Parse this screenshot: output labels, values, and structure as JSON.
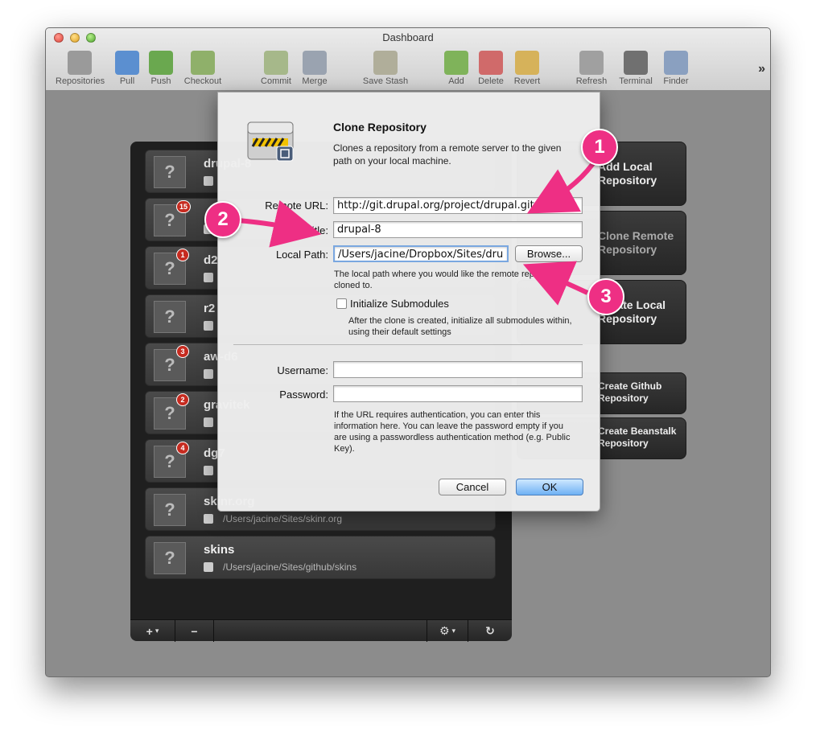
{
  "window": {
    "title": "Dashboard"
  },
  "toolbar": {
    "items": [
      {
        "label": "Repositories",
        "icon": "repositories-icon",
        "color": "#9a9a9a"
      },
      {
        "label": "Pull",
        "icon": "pull-icon",
        "color": "#5b8fd0"
      },
      {
        "label": "Push",
        "icon": "push-icon",
        "color": "#6aa84f"
      },
      {
        "label": "Checkout",
        "icon": "checkout-icon",
        "color": "#8fb06a"
      },
      {
        "label": "Commit",
        "icon": "commit-icon",
        "color": "#a6b88a"
      },
      {
        "label": "Merge",
        "icon": "merge-icon",
        "color": "#9aa3b0"
      },
      {
        "label": "Save Stash",
        "icon": "save-stash-icon",
        "color": "#b0ae9a"
      },
      {
        "label": "Add",
        "icon": "add-icon",
        "color": "#7fb35a"
      },
      {
        "label": "Delete",
        "icon": "delete-icon",
        "color": "#d06a6a"
      },
      {
        "label": "Revert",
        "icon": "revert-icon",
        "color": "#d6b25a"
      },
      {
        "label": "Refresh",
        "icon": "refresh-icon",
        "color": "#a0a0a0"
      },
      {
        "label": "Terminal",
        "icon": "terminal-icon",
        "color": "#707070"
      },
      {
        "label": "Finder",
        "icon": "finder-icon",
        "color": "#8aa0c0"
      }
    ],
    "more": "»"
  },
  "repos": [
    {
      "name": "drupal-8",
      "path": "",
      "badge": "",
      "thumb": "?"
    },
    {
      "name": "",
      "path": "",
      "badge": "15",
      "thumb": "?"
    },
    {
      "name": "d2",
      "path": "",
      "badge": "1",
      "thumb": "?"
    },
    {
      "name": "r2",
      "path": "",
      "badge": "",
      "thumb": "?"
    },
    {
      "name": "aw-d6",
      "path": "",
      "badge": "3",
      "thumb": "?"
    },
    {
      "name": "gravitek",
      "path": "",
      "badge": "2",
      "thumb": "?"
    },
    {
      "name": "dg7",
      "path": "",
      "badge": "4",
      "thumb": "?"
    },
    {
      "name": "skinr.org",
      "path": "/Users/jacine/Sites/skinr.org",
      "badge": "",
      "thumb": "?"
    },
    {
      "name": "skins",
      "path": "/Users/jacine/Sites/github/skins",
      "badge": "",
      "thumb": "?"
    }
  ],
  "panel_footer": {
    "add": "+",
    "remove": "−",
    "gear": "⚙",
    "refresh": "↻"
  },
  "actions": {
    "add_local": "Add Local Repository",
    "clone_remote": "Clone Remote Repository",
    "create_local": "Create Local Repository",
    "create_github": "Create Github Repository",
    "create_beanstalk": "Create Beanstalk Repository"
  },
  "dialog": {
    "title": "Clone Repository",
    "description": "Clones a repository from a remote server to the given path on your local machine.",
    "remote_url_label": "Remote URL:",
    "remote_url_value": "http://git.drupal.org/project/drupal.git",
    "title_label": "Title:",
    "title_value": "drupal-8",
    "local_path_label": "Local Path:",
    "local_path_value": "/Users/jacine/Dropbox/Sites/dru",
    "browse": "Browse...",
    "local_path_hint": "The local path where you would like the remote repository cloned to.",
    "init_submodules": "Initialize Submodules",
    "init_submodules_hint": "After the clone is created, initialize all submodules within, using their default settings",
    "username_label": "Username:",
    "username_value": "",
    "password_label": "Password:",
    "password_value": "",
    "auth_hint": "If the URL requires authentication, you can enter this information here. You can leave the password empty if you are using a passwordless authentication method (e.g. Public Key).",
    "cancel": "Cancel",
    "ok": "OK"
  },
  "annotations": {
    "one": "1",
    "two": "2",
    "three": "3"
  },
  "colors": {
    "accent_pink": "#ee2f84",
    "badge_red": "#c62b20",
    "ok_blue": "#6fb1f4"
  }
}
